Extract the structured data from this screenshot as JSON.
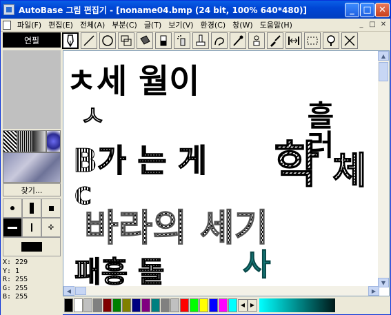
{
  "window": {
    "title": "AutoBase 그림 편집기 - [noname04.bmp (24 bit, 100% 640*480)]",
    "controls": {
      "minimize": "_",
      "maximize": "□",
      "close": "✕"
    }
  },
  "menubar": {
    "items": [
      "파일(F)",
      "편집(E)",
      "전체(A)",
      "부분(C)",
      "글(T)",
      "보기(V)",
      "환경(C)",
      "창(W)",
      "도움말(H)"
    ],
    "mdi_controls": [
      "_",
      "□",
      "✕"
    ]
  },
  "toolbar": {
    "mode_label": "연필",
    "tools": [
      {
        "name": "pen-tool-icon",
        "selected": true
      },
      {
        "name": "line-tool-icon"
      },
      {
        "name": "circle-tool-icon"
      },
      {
        "name": "rect-tool-icon"
      },
      {
        "name": "fill-tool-icon"
      },
      {
        "name": "eraser-tool-icon"
      },
      {
        "name": "spray-tool-icon"
      },
      {
        "name": "stamp-tool-icon"
      },
      {
        "name": "curve-tool-icon"
      },
      {
        "name": "dropper-tool-icon"
      },
      {
        "name": "magic-tool-icon"
      },
      {
        "name": "brush-tool-icon"
      },
      {
        "name": "resize-tool-icon"
      },
      {
        "name": "select-tool-icon"
      },
      {
        "name": "zoom-tool-icon"
      },
      {
        "name": "close-tool-icon"
      }
    ]
  },
  "left_panel": {
    "find_button": "찾기...",
    "coords": {
      "x": "X: 229",
      "y": "Y: 1",
      "r": "R: 255",
      "g": "G: 255",
      "b": "B: 255"
    }
  },
  "canvas": {
    "texts": [
      {
        "text": "ㅊ세 월이",
        "style": "bold-black"
      },
      {
        "text": "ㅅ",
        "style": "outline"
      },
      {
        "text": "흘러",
        "style": "bold-black"
      },
      {
        "text": "B가 는 게",
        "style": "mixed"
      },
      {
        "text": "학",
        "style": "bold-black"
      },
      {
        "text": "체",
        "style": "pattern"
      },
      {
        "text": "C",
        "style": "pattern"
      },
      {
        "text": "바라의 세기",
        "style": "mixed"
      },
      {
        "text": "패흥 돌",
        "style": "pattern"
      },
      {
        "text": "사",
        "style": "teal"
      }
    ]
  },
  "palette": {
    "colors": [
      "#000000",
      "#ffffff",
      "#c0c0c0",
      "#808080",
      "#800000",
      "#008000",
      "#808000",
      "#000080",
      "#800080",
      "#008080",
      "#808080",
      "#c0c0c0",
      "#ff0000",
      "#00ff00",
      "#ffff00",
      "#0000ff",
      "#ff00ff",
      "#00ffff"
    ],
    "gradient_start": "#00ffff",
    "gradient_end": "#001818"
  }
}
